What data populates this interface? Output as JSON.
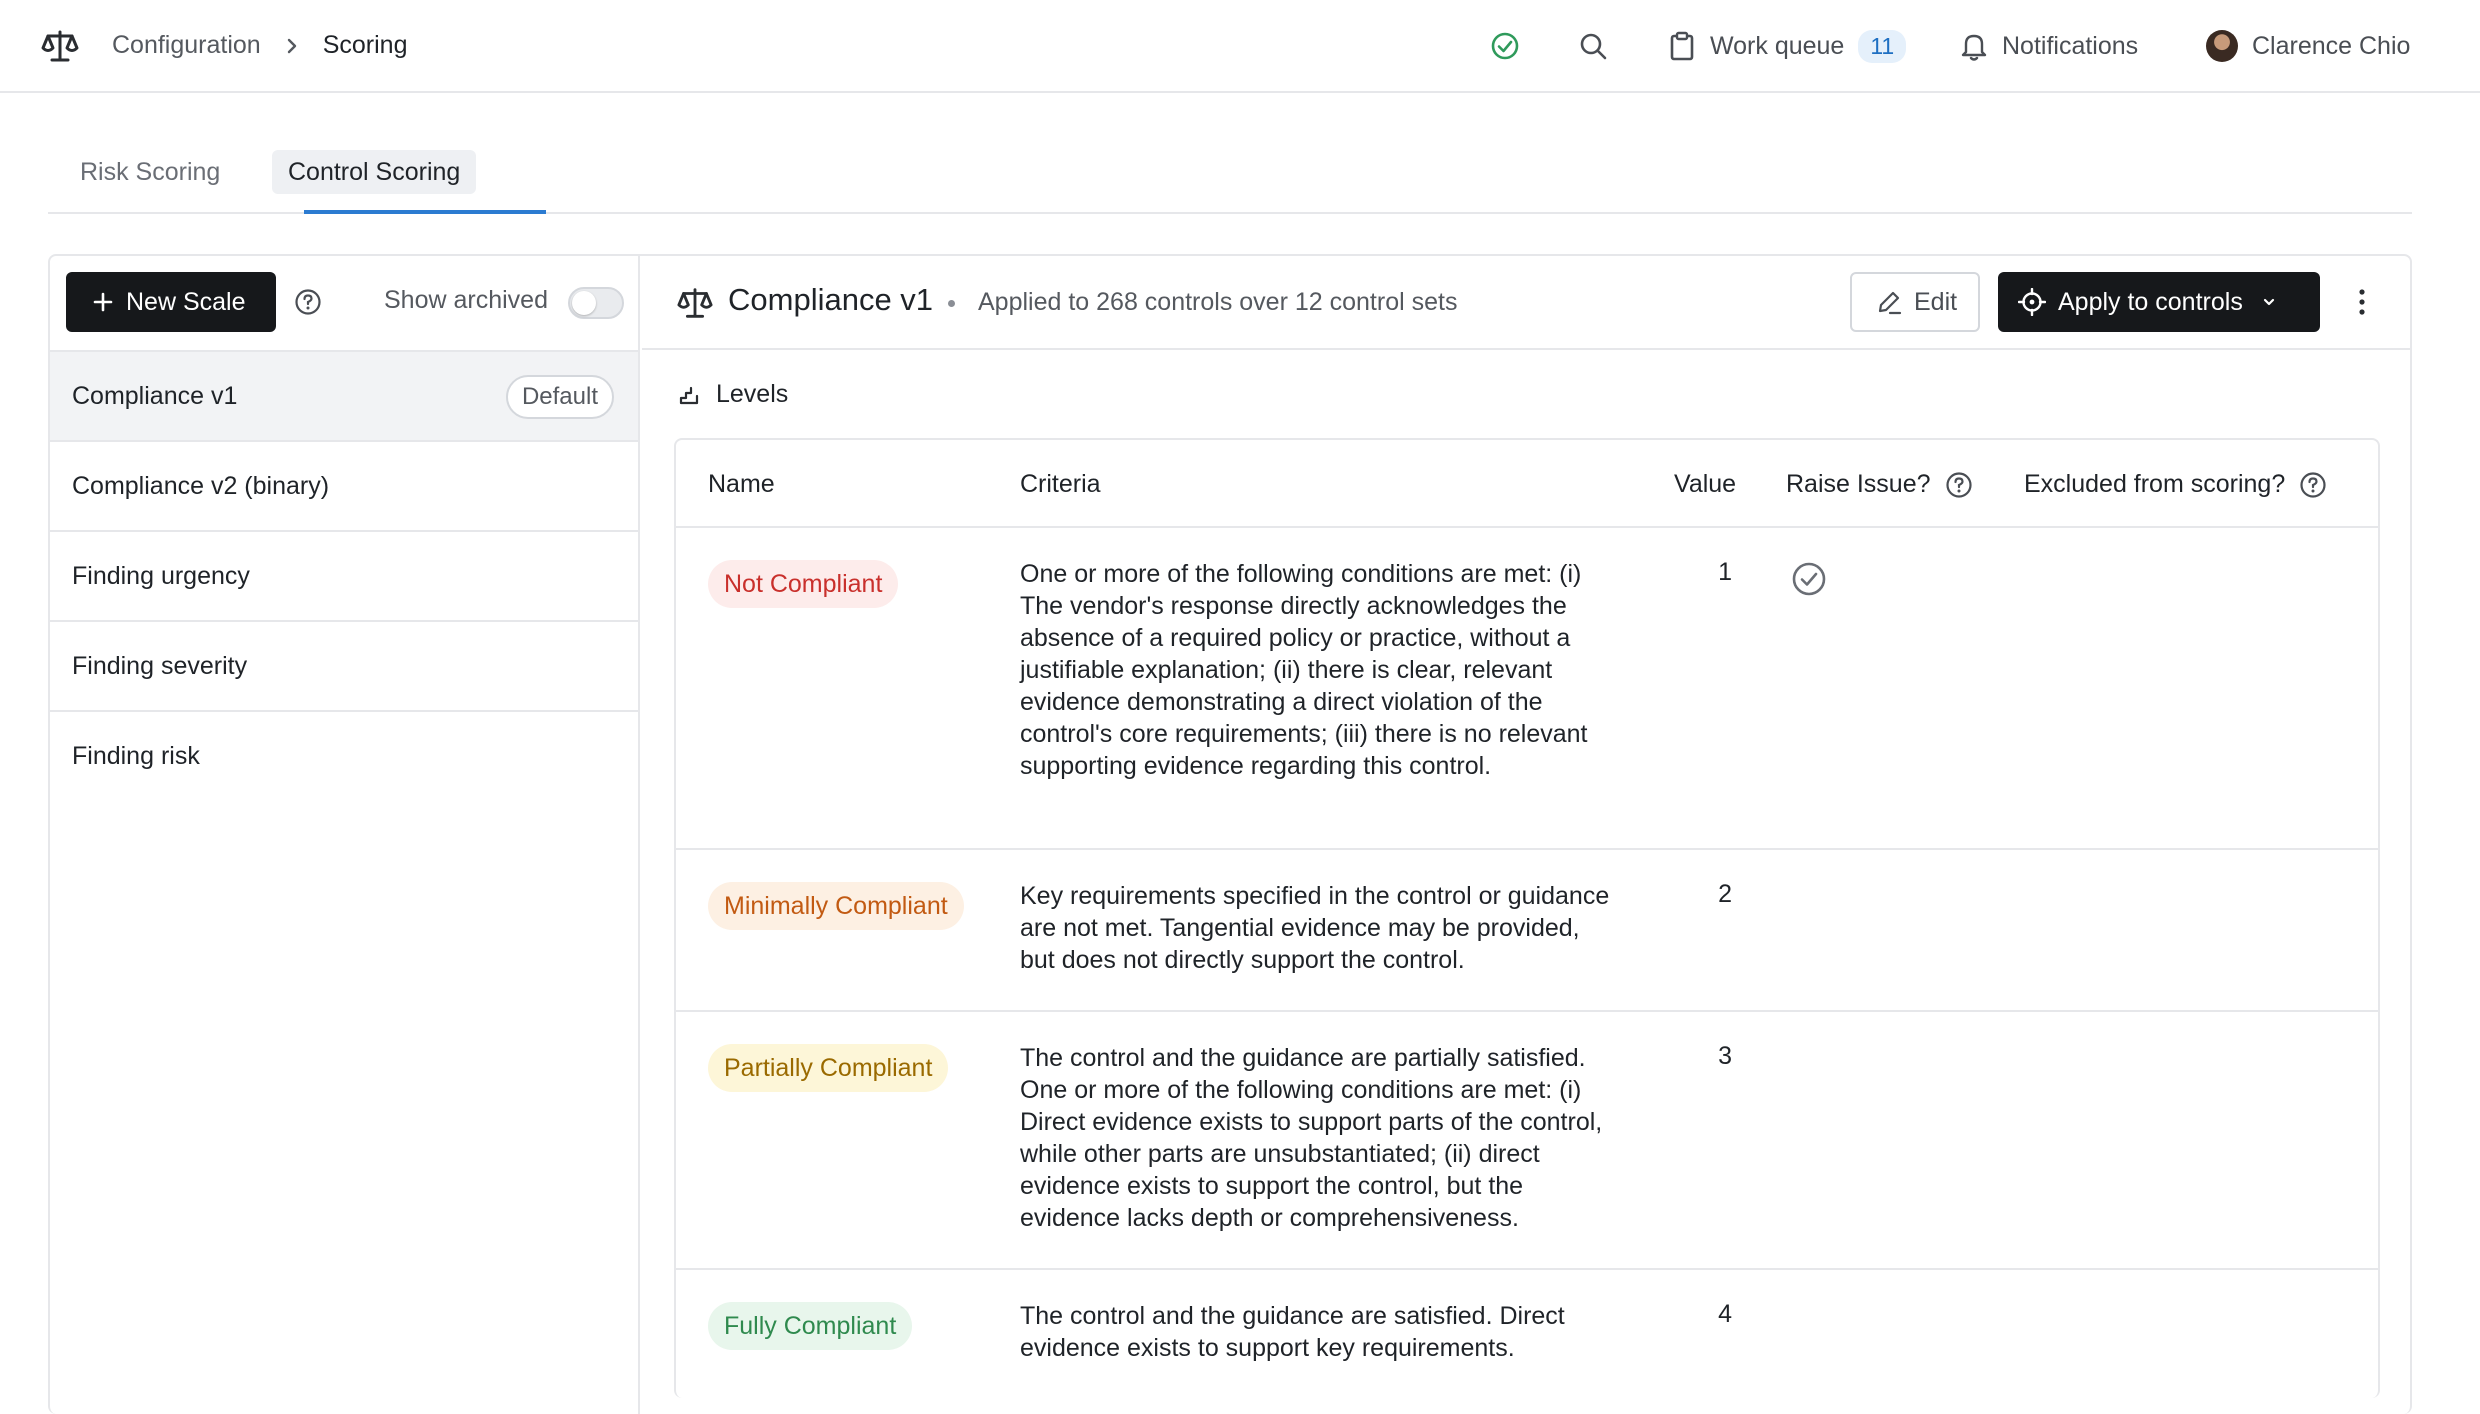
{
  "breadcrumb": {
    "parent": "Configuration",
    "current": "Scoring"
  },
  "topbar": {
    "work_queue_label": "Work queue",
    "work_queue_count": "11",
    "notifications_label": "Notifications",
    "user_name": "Clarence Chio"
  },
  "tabs": [
    {
      "label": "Risk Scoring",
      "active": false
    },
    {
      "label": "Control Scoring",
      "active": true
    }
  ],
  "sidebar": {
    "new_scale_label": "New Scale",
    "show_archived_label": "Show archived",
    "show_archived_on": false,
    "items": [
      {
        "label": "Compliance v1",
        "badge": "Default",
        "selected": true
      },
      {
        "label": "Compliance v2 (binary)"
      },
      {
        "label": "Finding urgency"
      },
      {
        "label": "Finding severity"
      },
      {
        "label": "Finding risk"
      }
    ]
  },
  "scale": {
    "title": "Compliance v1",
    "subtitle": "Applied to 268 controls over 12 control sets",
    "edit_label": "Edit",
    "apply_label": "Apply to controls",
    "levels_label": "Levels"
  },
  "table": {
    "headers": {
      "name": "Name",
      "criteria": "Criteria",
      "value": "Value",
      "raise_issue": "Raise Issue?",
      "excluded": "Excluded from scoring?"
    },
    "rows": [
      {
        "name": "Not Compliant",
        "color": "#c9302c",
        "bg": "#fdeceb",
        "criteria": "One or more of the following conditions are met: (i) The vendor's response directly acknowledges the absence of a required policy or practice, without a justifiable explanation; (ii) there is clear, relevant evidence demonstrating a direct violation of the control's core requirements; (iii) there is no relevant supporting evidence regarding this control.",
        "value": "1",
        "raise_issue": true
      },
      {
        "name": "Minimally Compliant",
        "color": "#c25a12",
        "bg": "#fdf0e3",
        "criteria": "Key requirements specified in the control or guidance are not met. Tangential evidence may be provided, but does not directly support the control.",
        "value": "2",
        "raise_issue": false
      },
      {
        "name": "Partially Compliant",
        "color": "#9a6a00",
        "bg": "#fdf6d8",
        "criteria": "The control and the guidance are partially satisfied. One or more of the following conditions are met: (i) Direct evidence exists to support parts of the control, while other parts are unsubstantiated; (ii) direct evidence exists to support the control, but the evidence lacks depth or comprehensiveness.",
        "value": "3",
        "raise_issue": false
      },
      {
        "name": "Fully Compliant",
        "color": "#2f8a4e",
        "bg": "#e8f6ec",
        "criteria": "The control and the guidance are satisfied. Direct evidence exists to support key requirements.",
        "value": "4",
        "raise_issue": false
      }
    ]
  }
}
